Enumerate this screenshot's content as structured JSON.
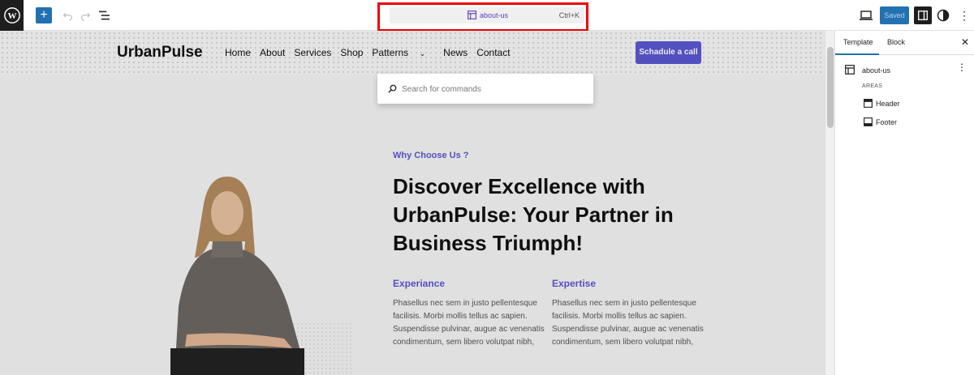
{
  "toolbar": {
    "doc_title": "about-us",
    "shortcut": "Ctrl+K",
    "saved_label": "Saved",
    "add_label": "+"
  },
  "site": {
    "brand": "UrbanPulse",
    "nav": [
      "Home",
      "About",
      "Services",
      "Shop",
      "Patterns",
      "News",
      "Contact"
    ],
    "cta": "Schadule a call"
  },
  "content": {
    "eyebrow": "Why Choose Us ?",
    "headline": "Discover Excellence with UrbanPulse: Your Partner in Business Triumph!",
    "columns": [
      {
        "title": "Experiance",
        "body": "Phasellus nec sem in justo pellentesque facilisis. Morbi mollis tellus ac sapien. Suspendisse pulvinar, augue ac venenatis condimentum, sem libero volutpat nibh,"
      },
      {
        "title": "Expertise",
        "body": "Phasellus nec sem in justo pellentesque facilisis. Morbi mollis tellus ac sapien. Suspendisse pulvinar, augue ac venenatis condimentum, sem libero volutpat nibh,"
      }
    ]
  },
  "command_palette": {
    "placeholder": "Search for commands"
  },
  "sidebar": {
    "tabs": [
      "Template",
      "Block"
    ],
    "close": "✕",
    "template_name": "about-us",
    "areas_label": "AREAS",
    "areas": [
      "Header",
      "Footer"
    ]
  },
  "colors": {
    "accent": "#5b57d1",
    "admin_blue": "#2271b1",
    "highlight": "#ee0000"
  },
  "icons": [
    "wordpress-logo-icon",
    "plus-icon",
    "undo-icon",
    "redo-icon",
    "list-view-icon",
    "template-icon",
    "desktop-icon",
    "sidebar-icon",
    "styles-icon",
    "kebab-icon",
    "search-icon",
    "close-icon",
    "header-area-icon",
    "footer-area-icon"
  ]
}
